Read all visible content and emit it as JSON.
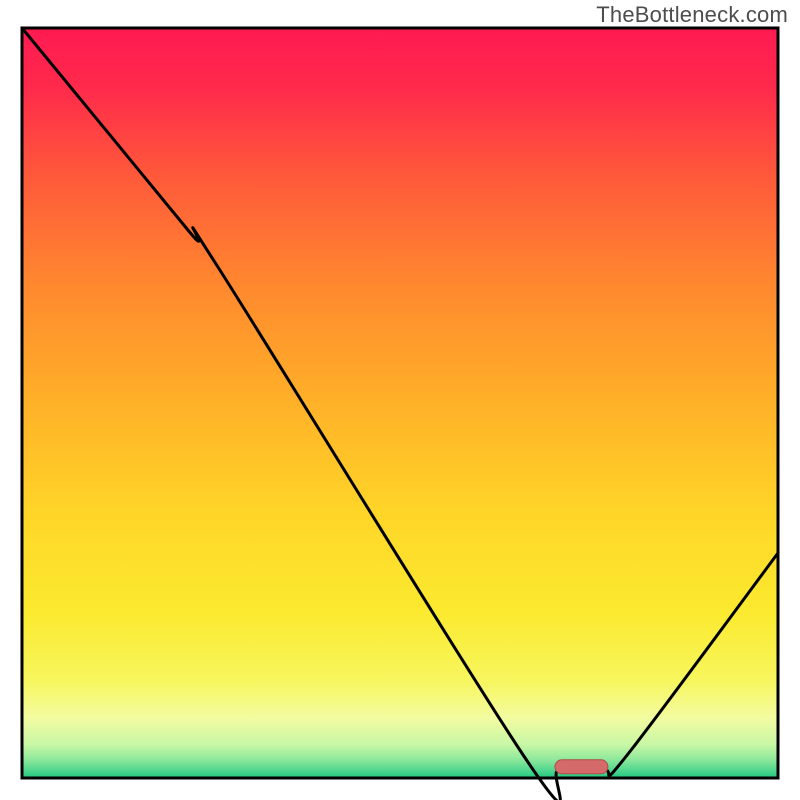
{
  "watermark": "TheBottleneck.com",
  "chart_data": {
    "type": "line",
    "title": "",
    "xlabel": "",
    "ylabel": "",
    "xlim": [
      0,
      100
    ],
    "ylim": [
      0,
      100
    ],
    "curve_points": [
      {
        "x": 0,
        "y": 100
      },
      {
        "x": 22,
        "y": 73
      },
      {
        "x": 26,
        "y": 68
      },
      {
        "x": 67,
        "y": 2
      },
      {
        "x": 71,
        "y": 1
      },
      {
        "x": 77,
        "y": 1
      },
      {
        "x": 80,
        "y": 3
      },
      {
        "x": 100,
        "y": 30
      }
    ],
    "optimal_marker": {
      "x_start": 70.5,
      "x_end": 77.5,
      "y": 1.5
    },
    "gradient_stops": [
      {
        "offset": 0.0,
        "color": "#ff1a52"
      },
      {
        "offset": 0.08,
        "color": "#ff2a4b"
      },
      {
        "offset": 0.2,
        "color": "#ff5a3a"
      },
      {
        "offset": 0.35,
        "color": "#ff8a2e"
      },
      {
        "offset": 0.5,
        "color": "#ffb128"
      },
      {
        "offset": 0.65,
        "color": "#ffd628"
      },
      {
        "offset": 0.78,
        "color": "#fbea2f"
      },
      {
        "offset": 0.87,
        "color": "#f7f65e"
      },
      {
        "offset": 0.92,
        "color": "#f3fca0"
      },
      {
        "offset": 0.955,
        "color": "#c9f7a6"
      },
      {
        "offset": 0.975,
        "color": "#8fe89b"
      },
      {
        "offset": 0.99,
        "color": "#4fd68f"
      },
      {
        "offset": 1.0,
        "color": "#1ec97e"
      }
    ],
    "border_color": "#000000",
    "curve_color": "#000000",
    "marker_fill": "#d46a6a",
    "marker_stroke": "#b54848"
  }
}
